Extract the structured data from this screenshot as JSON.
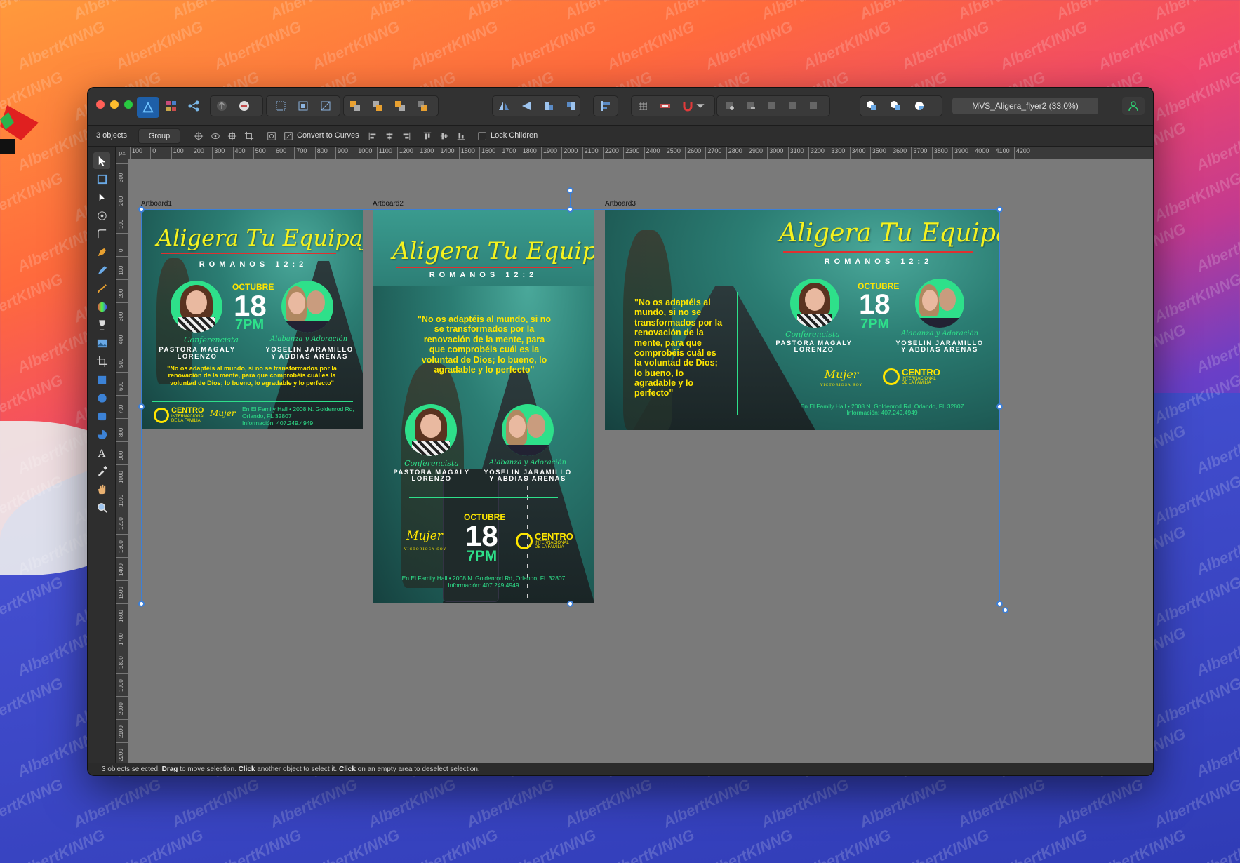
{
  "wallpaper": {
    "watermark": "AlbertKINNG"
  },
  "window": {
    "document_title": "MVS_Aligera_flyer2 (33.0%)",
    "context": {
      "selection_count": "3 objects",
      "group_button": "Group",
      "convert_button": "Convert to Curves",
      "lock_children": "Lock Children"
    },
    "ruler": {
      "unit": "px",
      "h_ticks": [
        "100",
        "0",
        "100",
        "200",
        "300",
        "400",
        "500",
        "600",
        "700",
        "800",
        "900",
        "1000",
        "1100",
        "1200",
        "1300",
        "1400",
        "1500",
        "1600",
        "1700",
        "1800",
        "1900",
        "2000",
        "2100",
        "2200",
        "2300",
        "2400",
        "2500",
        "2600",
        "2700",
        "2800",
        "2900",
        "3000",
        "3100",
        "3200",
        "3300",
        "3400",
        "3500",
        "3600",
        "3700",
        "3800",
        "3900",
        "4000",
        "4100",
        "4200"
      ],
      "v_ticks": [
        "300",
        "200",
        "100",
        "0",
        "100",
        "200",
        "300",
        "400",
        "500",
        "600",
        "700",
        "800",
        "900",
        "1000",
        "1100",
        "1200",
        "1300",
        "1400",
        "1500",
        "1600",
        "1700",
        "1800",
        "1900",
        "2000",
        "2100",
        "2200"
      ]
    },
    "status": {
      "p1": "3 objects selected. ",
      "b1": "Drag",
      "p2": " to move selection. ",
      "b2": "Click",
      "p3": " another object to select it. ",
      "b3": "Click",
      "p4": " on an empty area to deselect selection."
    }
  },
  "artboards": [
    {
      "label": "Artboard1"
    },
    {
      "label": "Artboard2"
    },
    {
      "label": "Artboard3"
    }
  ],
  "flyer": {
    "title": "Aligera Tu Equipaje",
    "verse": "ROMANOS 12:2",
    "month": "OCTUBRE",
    "day": "18",
    "time": "7PM",
    "speaker_role": "Conferencista",
    "speaker_name_l1": "PASTORA MAGALY",
    "speaker_name_l2": "LORENZO",
    "worship_role": "Alabanza y Adoración",
    "worship_name_l1": "YOSELIN JARAMILLO",
    "worship_name_l2": "Y ABDIAS ARENAS",
    "quote": "\"No os adaptéis al mundo, si no se transformados por la renovación de la mente, para que comprobéis cuál es la voluntad de Dios; lo bueno, lo agradable y lo perfecto\"",
    "address_l1": "En El Family Hall • 2008 N. Goldenrod Rd, Orlando, FL 32807",
    "address_a1_l1": "En El Family Hall • 2008 N. Goldenrod Rd,",
    "address_a1_l2": "Orlando, FL 32807",
    "info": "Información: 407.249.4949",
    "centro_big": "CENTRO",
    "centro_sub": "INTERNACIONAL DE LA FAMILIA",
    "mujer": "Mujer",
    "mujer_sub": "VICTORIOSA SOY"
  },
  "colors": {
    "accent_yellow": "#ffe600",
    "accent_green": "#2ee08a",
    "selection_blue": "#3d7fd6"
  }
}
